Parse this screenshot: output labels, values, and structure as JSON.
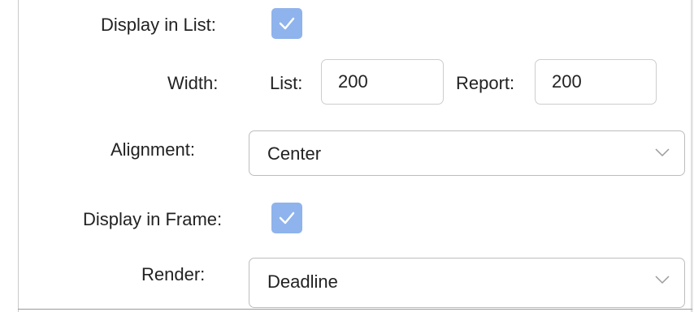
{
  "form": {
    "display_in_list": {
      "label": "Display in List:",
      "checked": true
    },
    "width": {
      "label": "Width:",
      "list_label": "List:",
      "list_value": "200",
      "report_label": "Report:",
      "report_value": "200"
    },
    "alignment": {
      "label": "Alignment:",
      "selected": "Center"
    },
    "display_in_frame": {
      "label": "Display in Frame:",
      "checked": true
    },
    "render": {
      "label": "Render:",
      "selected": "Deadline"
    }
  },
  "icons": {
    "checkbox_mark": "checkmark-icon",
    "dropdown": "chevron-down-icon"
  },
  "colors": {
    "checkbox_fill": "#8fb3ec",
    "field_border": "#cdcdcd",
    "text": "#222222"
  }
}
